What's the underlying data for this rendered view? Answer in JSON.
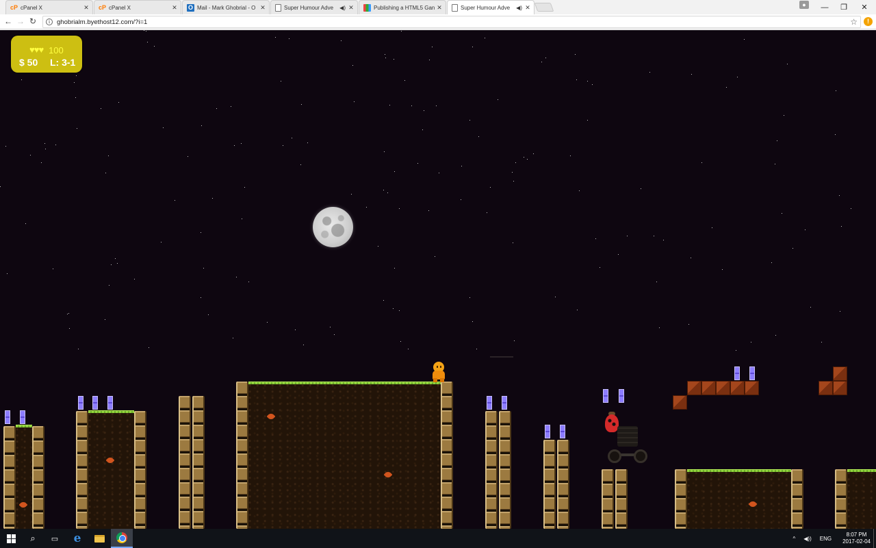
{
  "browser": {
    "tabs": [
      {
        "title": "cPanel X",
        "favicon": "cpanel-icon",
        "active": false,
        "audio": false
      },
      {
        "title": "cPanel X",
        "favicon": "cpanel-icon",
        "active": false,
        "audio": false
      },
      {
        "title": "Mail - Mark Ghobrial - O",
        "favicon": "outlook-icon",
        "active": false,
        "audio": false
      },
      {
        "title": "Super Humour Adve",
        "favicon": "page-icon",
        "active": false,
        "audio": true
      },
      {
        "title": "Publishing a HTML5 Gan",
        "favicon": "publish-icon",
        "active": false,
        "audio": false
      },
      {
        "title": "Super Humour Adve",
        "favicon": "page-icon",
        "active": true,
        "audio": true
      }
    ],
    "url": "ghobrialm.byethost12.com/?i=1"
  },
  "game": {
    "hud": {
      "hearts": "♥♥♥",
      "health": "100",
      "money": "$ 50",
      "level": "L: 3-1"
    },
    "colors": {
      "sky": "#0e0610",
      "hud_bg": "#cdbf12",
      "grass": "#8fd13a",
      "gem": "#8d7dff",
      "player": "#f5a316",
      "enemy": "#d42a2a"
    }
  },
  "taskbar": {
    "language": "ENG",
    "time": "8:07 PM",
    "date": "2017-02-04"
  }
}
